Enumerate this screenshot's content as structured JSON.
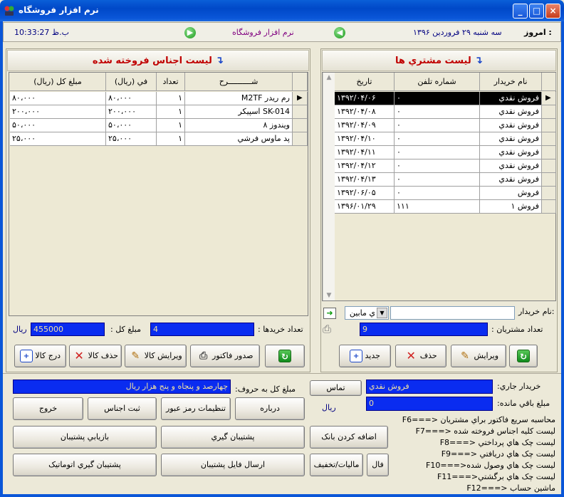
{
  "window": {
    "title": "نرم افزار فروشگاه"
  },
  "infobar": {
    "date_label": "امروز :",
    "date_value": "سه شنبه  ۲۹  فروردين  ۱۳۹۶",
    "app_name": "نرم افزار فروشگاه",
    "time": "10:33:27 ب.ظ"
  },
  "customers": {
    "title": "لیست مشتري ها",
    "columns": [
      "نام خريدار",
      "شماره تلفن",
      "تاريخ"
    ],
    "rows": [
      [
        "فروش نقدي",
        "۰",
        "۱۳۹۲/۰۴/۰۶"
      ],
      [
        "فروش نقدي",
        "۰",
        "۱۳۹۲/۰۴/۰۸"
      ],
      [
        "فروش نقدي",
        "۰",
        "۱۳۹۲/۰۴/۰۹"
      ],
      [
        "فروش نقدي",
        "۰",
        "۱۳۹۲/۰۴/۱۰"
      ],
      [
        "فروش نقدي",
        "۰",
        "۱۳۹۲/۰۴/۱۱"
      ],
      [
        "فروش نقدي",
        "۰",
        "۱۳۹۲/۰۴/۱۲"
      ],
      [
        "فروش نقدي",
        "۰",
        "۱۳۹۲/۰۴/۱۳"
      ],
      [
        "فروش",
        "۰",
        "۱۳۹۲/۰۶/۰۵"
      ],
      [
        "فروش ۱",
        "۱۱۱",
        "۱۳۹۶/۰۱/۲۹"
      ]
    ],
    "search_label": "نام خريدار:",
    "search_value": "",
    "combo_value": "ي مابين",
    "count_label": ": تعداد مشتريان",
    "count_value": "9",
    "buttons": {
      "edit": "ويرايش",
      "delete": "حذف",
      "new": "جديد"
    }
  },
  "items": {
    "title": "لیست اجناس فروخته شده",
    "columns": [
      "شــــــــــرح",
      "تعداد",
      "في (ريال)",
      "مبلغ کل (ريال)"
    ],
    "rows": [
      [
        "M2TF رم ريدر",
        "۱",
        "۸۰،۰۰۰",
        "۸۰،۰۰۰"
      ],
      [
        "اسپيکر SK-014",
        "۱",
        "۲۰۰،۰۰۰",
        "۲۰۰،۰۰۰"
      ],
      [
        "ويندوز ۸",
        "۱",
        "۵۰،۰۰۰",
        "۵۰،۰۰۰"
      ],
      [
        "پد ماوس فرشي",
        "۱",
        "۲۵،۰۰۰",
        "۲۵،۰۰۰"
      ]
    ],
    "purchases_label": ": تعداد خريدها",
    "purchases_value": "4",
    "total_label": ": مبلغ کل",
    "total_value": "455000",
    "currency": "ريال",
    "buttons": {
      "invoice": "صدور فاکتور",
      "edit_item": "ويرايش کالا",
      "delete_item": "حذف کالا",
      "insert_item": "درج کالا"
    }
  },
  "bottom": {
    "current_buyer_label": ":خريدار جاري",
    "current_buyer_value": "فروش نقدي",
    "remaining_label": ":مبلغ باقي مانده",
    "remaining_value": "0",
    "rial": "ريال",
    "contact": "تماس",
    "total_words_label": ":مبلغ کل به حروف",
    "total_words_value": "چهارصد و  پنجاه و پنج هزار ريال",
    "about": "درباره",
    "password": "تنظيمات رمز عبور",
    "register": "ثبت اجناس",
    "exit": "خروج",
    "add_bank": "اضافه کردن بانک",
    "backup": "پشتيبان گيري",
    "restore": "بازيابي پشتيبان",
    "fal": "فال",
    "tax": "ماليات/تخفيف",
    "send_backup": "ارسال فايل پشتيبان",
    "auto_backup": "پشتيبان گيري اتوماتيک"
  },
  "fkeys": [
    "F6===> محاسبه سريع فاکتور براي مشتريان",
    "F7===> ليست کليه اجناس فروخته شده",
    "F8===> ليست چک هاي پرداختي",
    "F9===> ليست چک هاي دريافتي",
    "F10===>ليست چک هاي وصول شده",
    "F11===>ليست چک هاي برگشتي",
    "F12===> ماشين حساب"
  ]
}
